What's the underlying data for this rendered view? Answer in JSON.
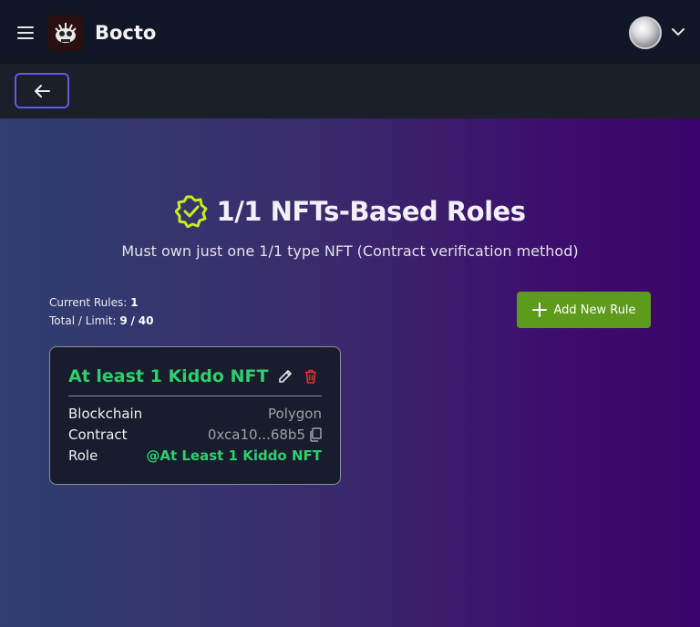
{
  "header": {
    "app_title": "Bocto",
    "menu_icon": "hamburger-menu-icon",
    "avatar_icon": "user-avatar",
    "caret_icon": "chevron-down-icon"
  },
  "subbar": {
    "back_icon": "arrow-left-icon"
  },
  "page": {
    "heading": "1/1 NFTs-Based Roles",
    "heading_icon": "verified-badge-icon",
    "subtitle": "Must own just one 1/1 type NFT (Contract verification method)",
    "current_rules_label": "Current Rules:",
    "current_rules_value": "1",
    "total_limit_label": "Total / Limit:",
    "total_value": "9",
    "limit_separator": "/",
    "limit_value": "40",
    "add_button_label": "Add New Rule"
  },
  "rules": [
    {
      "title": "At least 1 Kiddo NFT",
      "rows": [
        {
          "label": "Blockchain",
          "value": "Polygon"
        },
        {
          "label": "Contract",
          "value": "0xca10...68b5"
        },
        {
          "label": "Role",
          "value": "@At Least 1 Kiddo NFT"
        }
      ]
    }
  ],
  "colors": {
    "accent_green": "#2fcf6e",
    "button_green": "#5e9b1d",
    "badge_yellow": "#c7ee1a",
    "back_border": "#5d5bea",
    "delete_red": "#e0303a"
  }
}
